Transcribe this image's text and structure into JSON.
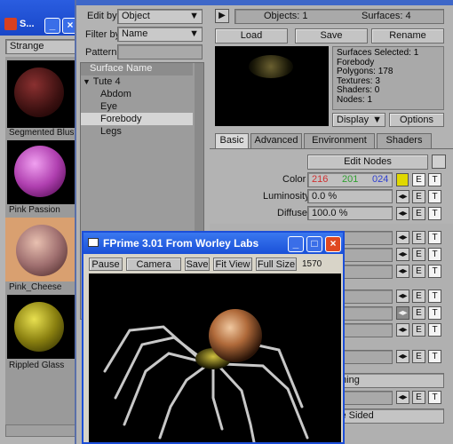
{
  "left_window": {
    "title": "S...",
    "dropdown": "Strange",
    "presets": [
      {
        "name": "Segmented Blus"
      },
      {
        "name": "Pink Passion"
      },
      {
        "name": "Pink_Cheese"
      },
      {
        "name": "Rippled Glass"
      }
    ]
  },
  "surface_editor": {
    "edit_by_label": "Edit by",
    "edit_by_value": "Object",
    "filter_by_label": "Filter by",
    "filter_by_value": "Name",
    "pattern_label": "Pattern",
    "pattern_value": "",
    "list_header": "Surface Name",
    "tree": [
      {
        "label": "Tute 4"
      },
      {
        "label": "Abdom"
      },
      {
        "label": "Eye"
      },
      {
        "label": "Forebody"
      },
      {
        "label": "Legs"
      }
    ],
    "objects_count": "Objects: 1",
    "surfaces_count": "Surfaces: 4",
    "load": "Load",
    "save": "Save",
    "rename": "Rename",
    "info": [
      "Surfaces Selected: 1",
      "Forebody",
      "Polygons: 178",
      "Textures: 3",
      "Shaders: 0",
      "Nodes: 1"
    ],
    "display": "Display",
    "options": "Options",
    "tabs": [
      "Basic",
      "Advanced",
      "Environment",
      "Shaders"
    ],
    "edit_nodes": "Edit Nodes",
    "color_label": "Color",
    "color_r": "216",
    "color_g": "201",
    "color_b": "024",
    "swatch": "#e0d800",
    "luminosity_label": "Luminosity",
    "luminosity_value": "0.0 %",
    "diffuse_label": "Diffuse",
    "diffuse_value": "100.0 %",
    "e": "E",
    "t": "T",
    "smoothing_fragment": "thing",
    "double_sided_fragment": "le Sided"
  },
  "fprime": {
    "title": "FPrime 3.01 From Worley Labs",
    "pause": "Pause",
    "camera": "Camera",
    "save": "Save",
    "fit_view": "Fit View",
    "full_size": "Full Size",
    "pass_count": "1570"
  }
}
